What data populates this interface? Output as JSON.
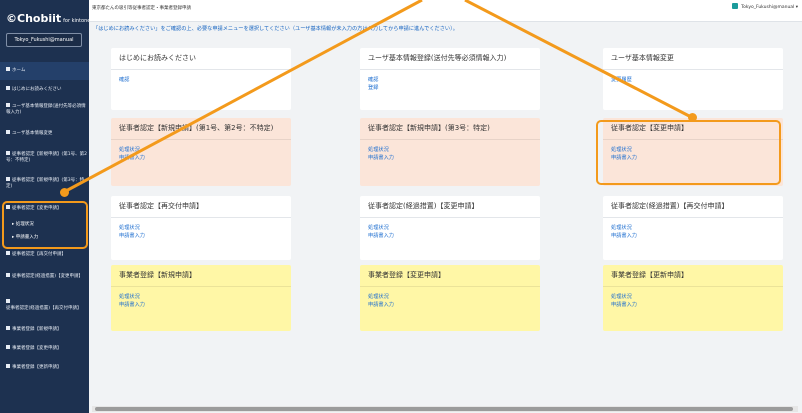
{
  "app": {
    "logo_main": "Chobiit",
    "logo_sub": "for kintone"
  },
  "user": {
    "name": "Tokyo_Fukushi@manual",
    "menu": "Tokyo_Fukushi@manual ▾"
  },
  "breadcrumb": "東京都たんの吸引等従事者認定・事業者登録申請",
  "notice": "「はじめにお読みください」をご確認の上、必要な申請メニューを選択してください（ユーザ基本情報が未入力の方は入力してから申請に進んでください）。",
  "sidebar": {
    "home": "ホーム",
    "items": [
      "はじめにお読みください",
      "ユーザ基本情報登録(送付先等必須情報入力)",
      "ユーザ基本情報変更",
      "従事者認定【新規申請】(第1号、第2号：不特定)",
      "従事者認定【新規申請】(第3号：特定)",
      "従事者認定【変更申請】",
      "従事者認定【再交付申請】",
      "従事者認定(経過措置)【変更申請】",
      "従事者認定(経過措置)【再交付申請】",
      "事業者登録【新規申請】",
      "事業者登録【変更申請】",
      "事業者登録【更新申請】"
    ],
    "sub_items": [
      "処理状況",
      "申請書入力"
    ]
  },
  "cards": [
    {
      "title": "はじめにお読みください",
      "links": [
        "確認"
      ]
    },
    {
      "title": "ユーザ基本情報登録(送付先等必須情報入力)",
      "links": [
        "確認",
        "登録"
      ]
    },
    {
      "title": "ユーザ基本情報変更",
      "links": [
        "変更履歴"
      ]
    },
    {
      "title": "従事者認定【新規申請】(第1号、第2号：不特定)",
      "links": [
        "処理状況",
        "申請書入力"
      ]
    },
    {
      "title": "従事者認定【新規申請】(第3号：特定)",
      "links": [
        "処理状況",
        "申請書入力"
      ]
    },
    {
      "title": "従事者認定【変更申請】",
      "links": [
        "処理状況",
        "申請書入力"
      ]
    },
    {
      "title": "従事者認定【再交付申請】",
      "links": [
        "処理状況",
        "申請書入力"
      ]
    },
    {
      "title": "従事者認定(経過措置)【変更申請】",
      "links": [
        "処理状況",
        "申請書入力"
      ]
    },
    {
      "title": "従事者認定(経過措置)【再交付申請】",
      "links": [
        "処理状況",
        "申請書入力"
      ]
    },
    {
      "title": "事業者登録【新規申請】",
      "links": [
        "処理状況",
        "申請書入力"
      ]
    },
    {
      "title": "事業者登録【変更申請】",
      "links": [
        "処理状況",
        "申請書入力"
      ]
    },
    {
      "title": "事業者登録【更新申請】",
      "links": [
        "処理状況",
        "申請書入力"
      ]
    }
  ],
  "colors": {
    "sidebar": "#1d3150",
    "accent": "#f39a1c",
    "link": "#1f6fd0",
    "peach": "#fbe5d9",
    "yellow": "#fff7a6"
  }
}
